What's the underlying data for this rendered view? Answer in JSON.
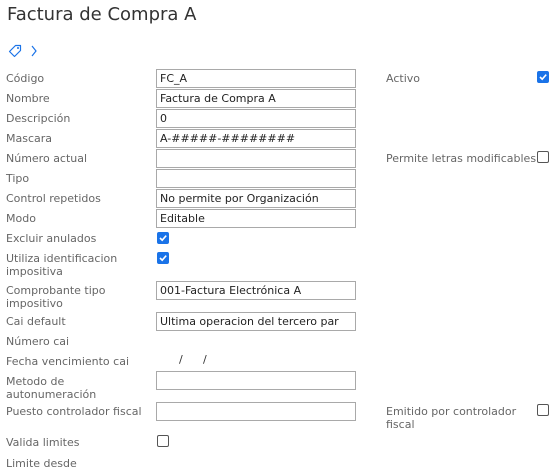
{
  "header": {
    "title": "Factura de Compra A"
  },
  "icons": {
    "tag": "tag-icon",
    "chevron": "chevron-right-icon",
    "accent": "#1a73e8"
  },
  "form": {
    "codigo": {
      "label": "Código",
      "value": "FC_A"
    },
    "nombre": {
      "label": "Nombre",
      "value": "Factura de Compra A"
    },
    "descripcion": {
      "label": "Descripción",
      "value": "0"
    },
    "mascara": {
      "label": "Mascara",
      "value": "A-#####-########"
    },
    "numero_actual": {
      "label": "Número actual",
      "value": ""
    },
    "tipo": {
      "label": "Tipo",
      "value": ""
    },
    "control_repetidos": {
      "label": "Control repetidos",
      "value": "No permite por Organización"
    },
    "modo": {
      "label": "Modo",
      "value": "Editable"
    },
    "excluir_anulados": {
      "label": "Excluir anulados",
      "checked": true
    },
    "utiliza_identificacion": {
      "label_line1": "Utiliza identificacion",
      "label_line2": "impositiva",
      "checked": true
    },
    "comprobante_tipo": {
      "label_line1": "Comprobante tipo",
      "label_line2": "impositivo",
      "value": "001-Factura Electrónica A"
    },
    "cai_default": {
      "label": "Cai default",
      "value": "Ultima operacion del tercero par"
    },
    "numero_cai": {
      "label": "Número cai"
    },
    "fecha_vencimiento_cai": {
      "label": "Fecha vencimiento cai",
      "separator": "/"
    },
    "metodo_autonumeracion": {
      "label_line1": "Metodo de",
      "label_line2": "autonumeración",
      "value": ""
    },
    "puesto_controlador": {
      "label": "Puesto controlador fiscal",
      "value": ""
    },
    "valida_limites": {
      "label": "Valida limites",
      "checked": false
    },
    "limite_desde": {
      "label": "Limite desde"
    },
    "activo": {
      "label": "Activo",
      "checked": true
    },
    "permite_letras": {
      "label": "Permite letras modificables",
      "checked": false
    },
    "emitido_controlador": {
      "label_line1": "Emitido por controlador",
      "label_line2": "fiscal",
      "checked": false
    }
  }
}
